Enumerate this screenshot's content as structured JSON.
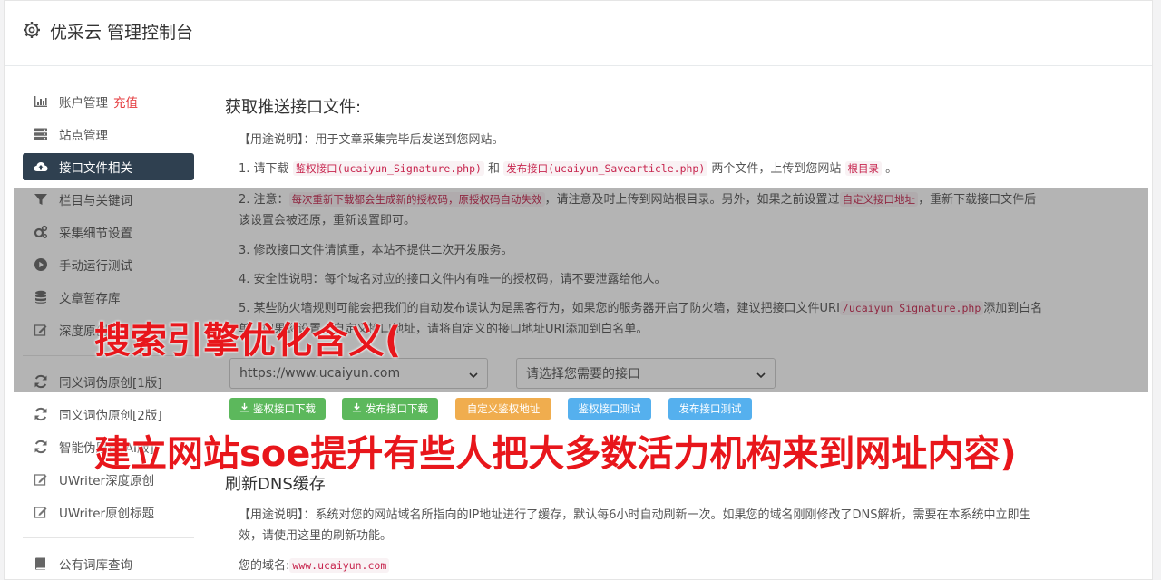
{
  "header": {
    "title": "优采云 管理控制台",
    "icon": "gear-icon"
  },
  "sidebar": {
    "items": [
      {
        "label": "账户管理",
        "extra": "充值",
        "icon": "bar-chart-icon"
      },
      {
        "label": "站点管理",
        "icon": "server-icon"
      },
      {
        "label": "接口文件相关",
        "icon": "cloud-upload-icon",
        "active": true
      },
      {
        "label": "栏目与关键词",
        "icon": "filter-icon"
      },
      {
        "label": "采集细节设置",
        "icon": "cogs-icon"
      },
      {
        "label": "手动运行测试",
        "icon": "play-circle-icon"
      },
      {
        "label": "文章暂存库",
        "icon": "database-icon"
      },
      {
        "label": "深度原创",
        "icon": "edit-icon"
      },
      {
        "label": "同义词伪原创[1版]",
        "icon": "refresh-icon"
      },
      {
        "label": "同义词伪原创[2版]",
        "icon": "refresh-icon"
      },
      {
        "label": "智能伪原创[AI版]",
        "icon": "refresh-icon"
      },
      {
        "label": "UWriter深度原创",
        "icon": "edit-icon"
      },
      {
        "label": "UWriter原创标题",
        "icon": "edit-icon"
      },
      {
        "label": "公有词库查询",
        "icon": "book-icon"
      }
    ]
  },
  "section1": {
    "title": "获取推送接口文件:",
    "usage_label": "【用途说明】",
    "usage_text": "：用于文章采集完毕后发送到您网站。",
    "item1": {
      "a": "1. 请下载 ",
      "code1": "鉴权接口(ucaiyun_Signature.php)",
      "b": " 和 ",
      "code2": "发布接口(ucaiyun_Savearticle.php)",
      "c": " 两个文件，上传到您网站 ",
      "code3": "根目录",
      "d": " 。"
    },
    "item2": {
      "a": "2. 注意：",
      "code1": "每次重新下载都会生成新的授权码，原授权码自动失效",
      "b": "，请注意及时上传到网站根目录。另外，如果之前设置过",
      "code2": "自定义接口地址",
      "c": "，重新下载接口文件后该设置会被还原，重新设置即可。"
    },
    "item3": "3. 修改接口文件请慎重，本站不提供二次开发服务。",
    "item4": "4. 安全性说明：每个域名对应的接口文件内有唯一的授权码，请不要泄露给他人。",
    "item5": {
      "a": "5. 某些防火墙规则可能会把我们的自动发布误认为是黑客行为，如果您的服务器开启了防火墙，建议把接口文件URI",
      "code1": "/ucaiyun_Signature.php",
      "b": "添加到白名单。如果您设置了自定义接口地址，请将自定义的接口地址URI添加到白名单。"
    },
    "site_select": "https://www.ucaiyun.com",
    "iface_select": "请选择您需要的接口",
    "buttons": {
      "dl_sign": "鉴权接口下载",
      "dl_publish": "发布接口下载",
      "custom_addr": "自定义鉴权地址",
      "test_sign": "鉴权接口测试",
      "test_publish": "发布接口测试"
    }
  },
  "section2": {
    "title": "刷新DNS缓存",
    "usage_label": "【用途说明】",
    "usage_text": "：系统对您的网站域名所指向的IP地址进行了缓存，默认每6小时自动刷新一次。如果您的域名刚刚修改了DNS解析，需要在本系统中立即生效，请使用这里的刷新功能。",
    "domain_label": "您的域名:",
    "domain_value": "www.ucaiyun.com"
  },
  "overlay": {
    "line1": "搜索引擎优化含义(",
    "line2": "建立网站soe提升有些人把大多数活力机构来到网址内容)"
  },
  "colors": {
    "sidebar_active": "#2f4050",
    "accent_red": "#e4393c",
    "banner_red": "#e8161b"
  }
}
